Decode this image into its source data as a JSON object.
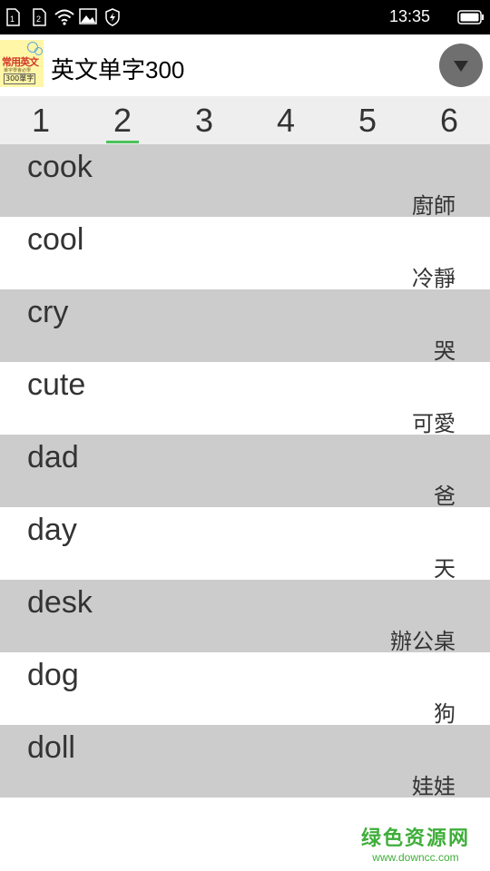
{
  "status_bar": {
    "sim1_label": "1",
    "sim2_label": "2",
    "time": "13:35",
    "icons": [
      "sim-card-icon",
      "sim-card-icon",
      "wifi-icon",
      "gallery-notification-icon",
      "security-shield-icon",
      "battery-icon"
    ]
  },
  "app_bar": {
    "title": "英文单字300",
    "logo_text_1": "常用英文",
    "logo_text_2": "單字學會必學",
    "logo_text_3": "300單字",
    "menu_icon": "dropdown-arrow-icon"
  },
  "tabs": [
    {
      "label": "1"
    },
    {
      "label": "2"
    },
    {
      "label": "3"
    },
    {
      "label": "4"
    },
    {
      "label": "5"
    },
    {
      "label": "6"
    }
  ],
  "active_tab": "2",
  "colors": {
    "indicator": "#4cc25a",
    "shaded_row": "#cccccc",
    "watermark": "#3fae3a"
  },
  "words": [
    {
      "en": "cook",
      "zh": "廚師"
    },
    {
      "en": "cool",
      "zh": "冷靜"
    },
    {
      "en": "cry",
      "zh": "哭"
    },
    {
      "en": "cute",
      "zh": "可愛"
    },
    {
      "en": "dad",
      "zh": "爸"
    },
    {
      "en": "day",
      "zh": "天"
    },
    {
      "en": "desk",
      "zh": "辦公桌"
    },
    {
      "en": "dog",
      "zh": "狗"
    },
    {
      "en": "doll",
      "zh": "娃娃"
    }
  ],
  "watermark": {
    "main": "绿色资源网",
    "sub": "www.downcc.com"
  }
}
